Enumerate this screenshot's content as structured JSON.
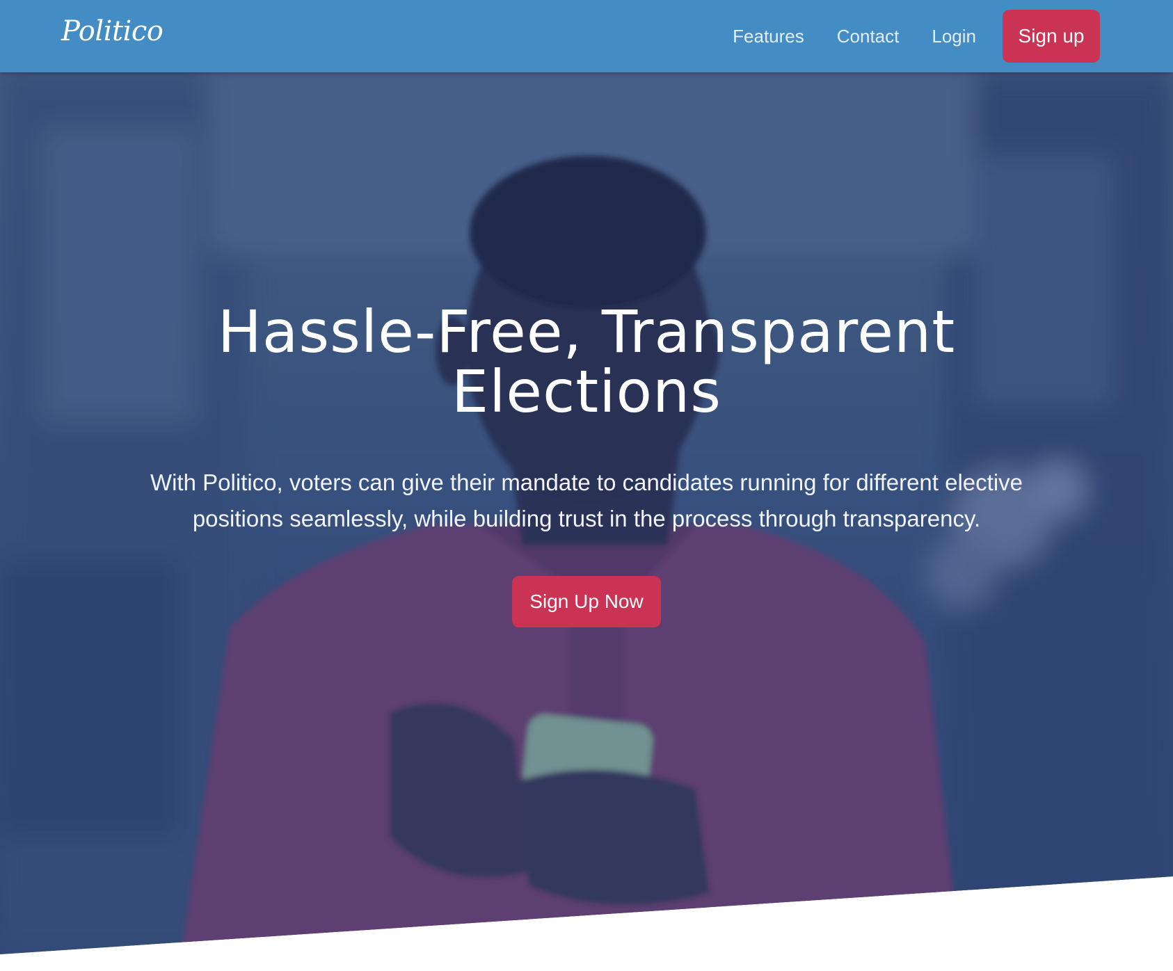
{
  "navbar": {
    "brand": "Politico",
    "links": {
      "features": "Features",
      "contact": "Contact",
      "login": "Login"
    },
    "signup_label": "Sign up",
    "bg_color": "#438dc4"
  },
  "hero": {
    "title": "Hassle-Free, Transparent Elections",
    "text": "With Politico, voters can give their mandate to candidates running for different elective positions seamlessly, while building trust in the process through transparency.",
    "cta_label": "Sign Up Now",
    "accent_color": "#cb3355"
  }
}
